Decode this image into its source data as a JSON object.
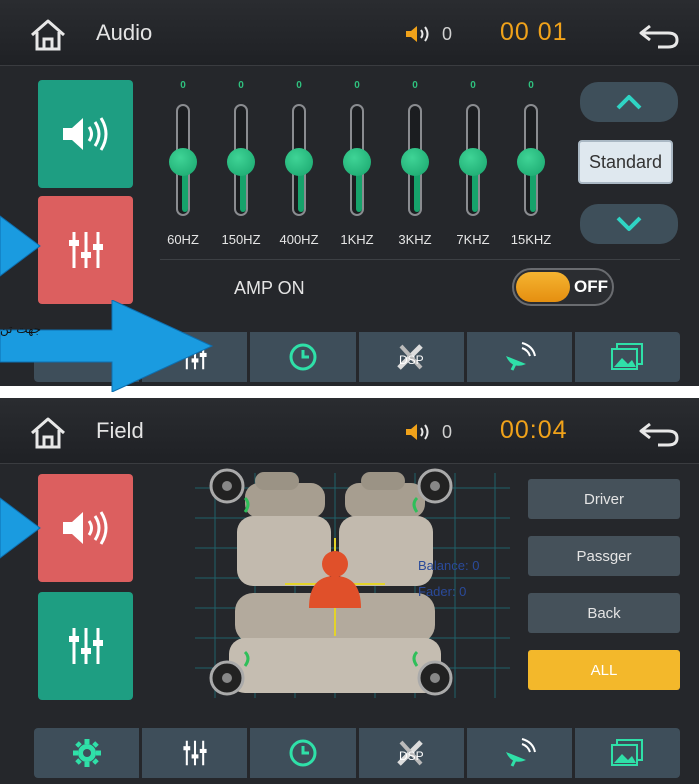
{
  "audio_screen": {
    "title": "Audio",
    "volume": "0",
    "clock": "00 01",
    "eq_bands": [
      {
        "freq": "60HZ",
        "value": "0",
        "level": 0.5
      },
      {
        "freq": "150HZ",
        "value": "0",
        "level": 0.5
      },
      {
        "freq": "400HZ",
        "value": "0",
        "level": 0.5
      },
      {
        "freq": "1KHZ",
        "value": "0",
        "level": 0.5
      },
      {
        "freq": "3KHZ",
        "value": "0",
        "level": 0.5
      },
      {
        "freq": "7KHZ",
        "value": "0",
        "level": 0.5
      },
      {
        "freq": "15KHZ",
        "value": "0",
        "level": 0.5
      }
    ],
    "preset": "Standard",
    "amp_label": "AMP ON",
    "amp_state": "OFF"
  },
  "field_screen": {
    "title": "Field",
    "volume": "0",
    "clock": "00:04",
    "balance_text": "Balance: 0",
    "fader_text": "Fader: 0",
    "buttons": [
      "Driver",
      "Passger",
      "Back",
      "ALL"
    ],
    "active_button": "ALL"
  },
  "annotation_text": "جهت تن",
  "icons": {
    "home": "home-icon",
    "volume": "speaker-volume-icon",
    "back": "return-arrow-icon",
    "audio": "speaker-volume-icon",
    "eq": "equalizer-sliders-icon",
    "clock": "clock-icon",
    "settings_tool": "tools-icon",
    "satellite": "satellite-dish-icon",
    "gallery": "gallery-icon",
    "gear": "gear-icon",
    "up": "chevron-up-icon",
    "down": "chevron-down-icon"
  },
  "colors": {
    "accent_green": "#1e9e82",
    "accent_red": "#dc5f5f",
    "accent_orange": "#f0a21a",
    "eq_green": "#2fc07e",
    "annotation_blue": "#1a9be0"
  }
}
